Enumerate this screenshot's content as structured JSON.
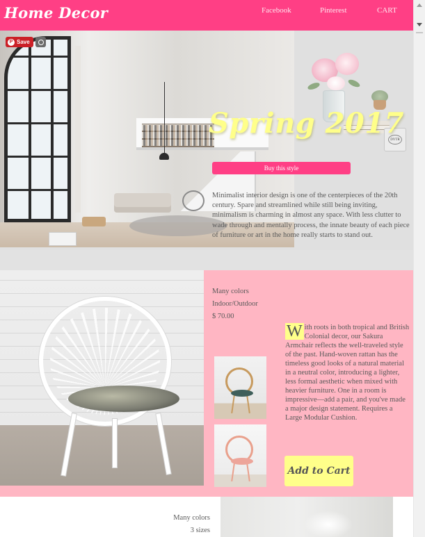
{
  "header": {
    "logo": "Home Decor",
    "nav": {
      "facebook": "Facebook",
      "pinterest": "Pinterest",
      "cart": "CART"
    },
    "color": "#ff3f85"
  },
  "hero": {
    "save_label": "Save",
    "title": "Spring 2017",
    "buy_label": "Buy this style",
    "text": "Minimalist interior design is one of the centerpieces of the 20th century. Spare and streamlined while still being inviting, minimalism is charming in almost any space. With less clutter to wade through and mentally process, the innate beauty of each piece of furniture or art in the home really starts to stand out.",
    "candle_label": "DYTR"
  },
  "product": {
    "colors": "Many colors",
    "usage": "Indoor/Outdoor",
    "price": "$ 70.00",
    "desc_first": "W",
    "desc_rest": "ith roots in both tropical and British Colonial decor, our Sakura Armchair reflects the well-traveled style of the past. Hand-woven rattan has the timeless good looks of a natural material in a neutral color, introducing a lighter, less formal aesthetic when mixed with heavier furniture. One in a room is impressive—add a pair, and you've made a major design statement. Requires a Large Modular Cushion.",
    "add_to_cart": "Add to Cart",
    "bg_color": "#ffb6c3",
    "accent_color": "#ffff8a"
  },
  "bottom": {
    "colors": "Many colors",
    "sizes": "3 sizes"
  }
}
